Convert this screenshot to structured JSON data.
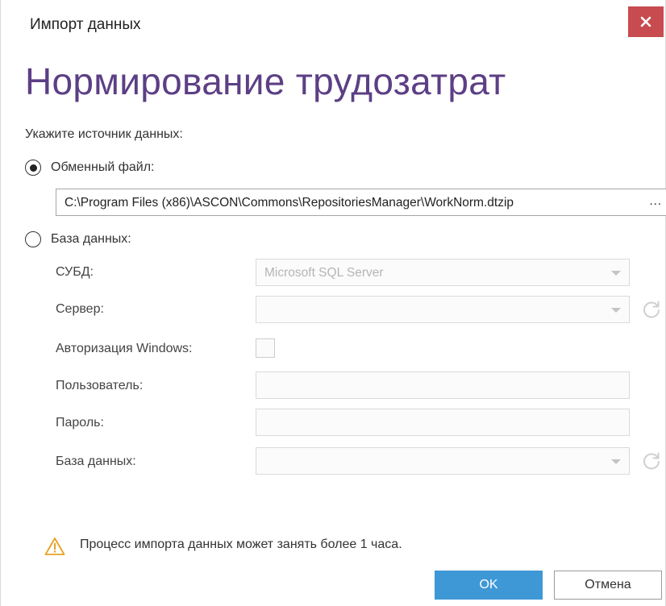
{
  "window": {
    "title": "Импорт данных",
    "close_label": "×"
  },
  "heading": "Нормирование трудозатрат",
  "source_prompt": "Укажите источник данных:",
  "exchange_file": {
    "label": "Обменный файл:",
    "selected": true,
    "path": "C:\\Program Files (x86)\\ASCON\\Commons\\RepositoriesManager\\WorkNorm.dtzip",
    "browse_label": "..."
  },
  "database": {
    "label": "База данных:",
    "selected": false,
    "fields": {
      "dbms_label": "СУБД:",
      "dbms_value": "Microsoft SQL Server",
      "server_label": "Сервер:",
      "server_value": "",
      "windows_auth_label": "Авторизация Windows:",
      "windows_auth_checked": false,
      "user_label": "Пользователь:",
      "user_value": "",
      "password_label": "Пароль:",
      "password_value": "",
      "database_label": "База данных:",
      "database_value": ""
    }
  },
  "warning": "Процесс импорта данных может занять более 1 часа.",
  "buttons": {
    "ok": "OK",
    "cancel": "Отмена"
  },
  "colors": {
    "heading": "#5c3f85",
    "close_button": "#c74b4f",
    "primary_button": "#3f98d6",
    "warning_icon": "#e8a020"
  }
}
